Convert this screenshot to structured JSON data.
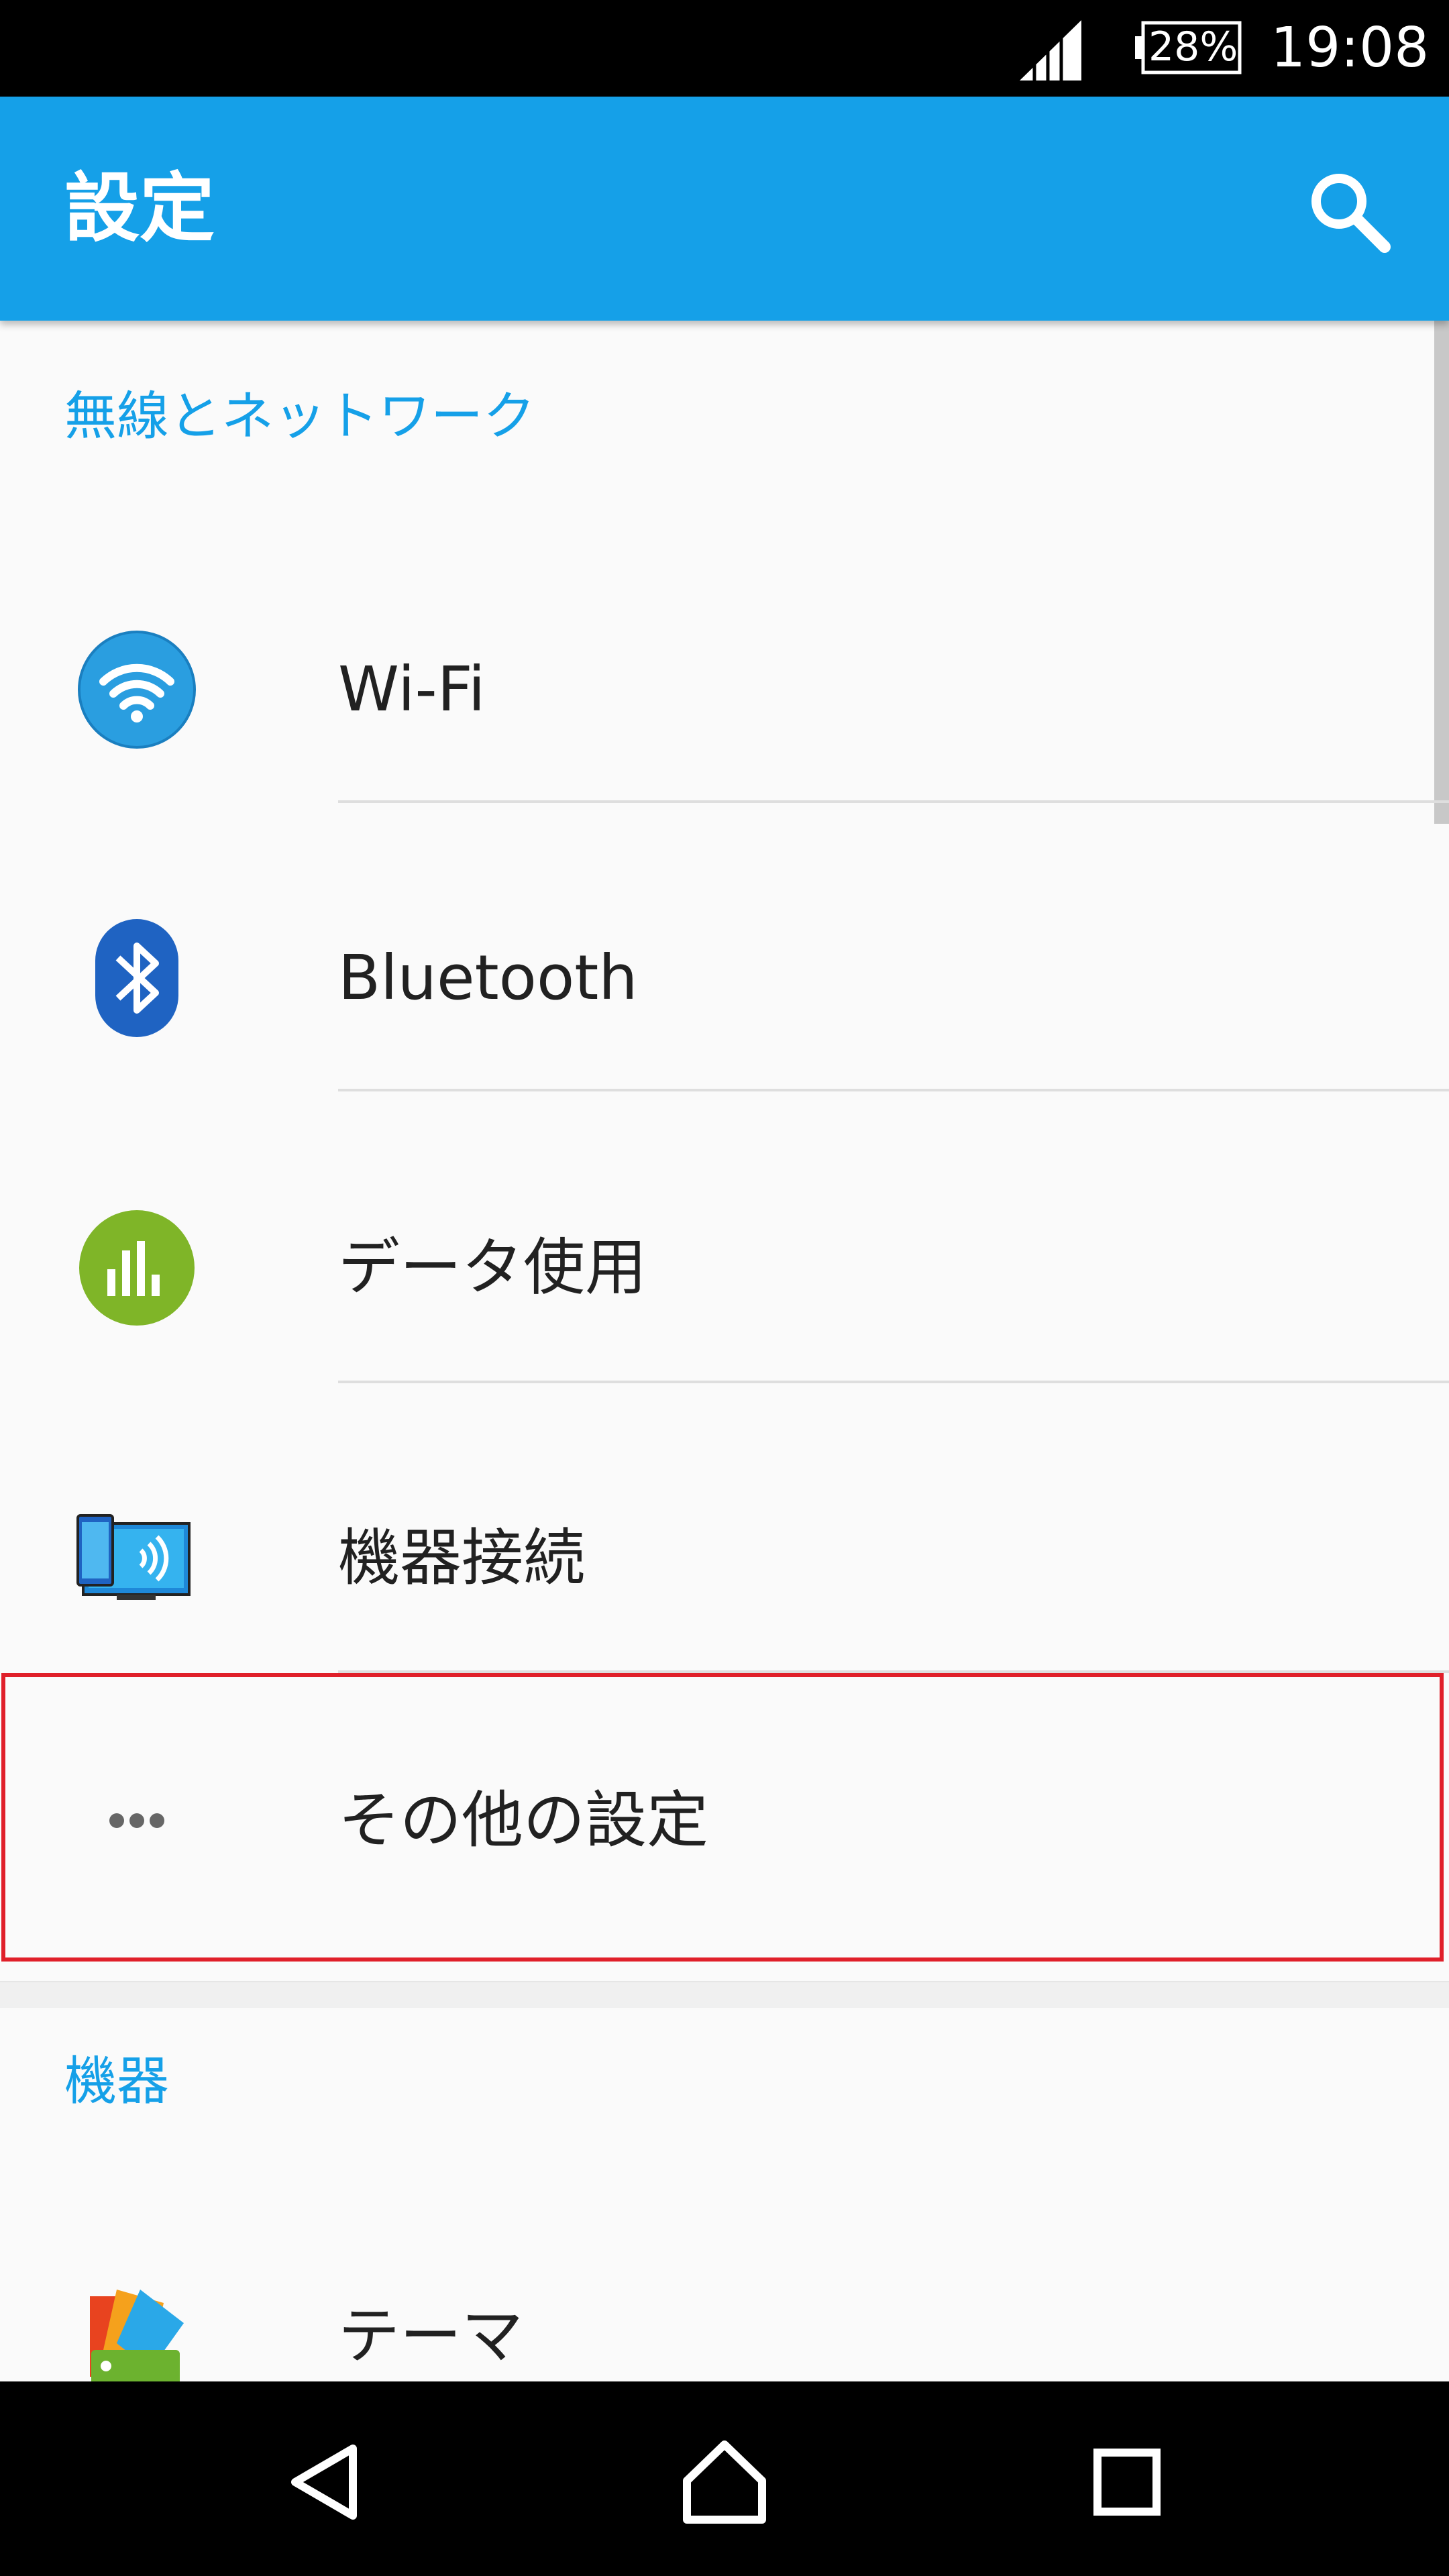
{
  "status_bar": {
    "battery": "28%",
    "time": "19:08",
    "icons": [
      "signal-icon",
      "battery-icon"
    ]
  },
  "app_bar": {
    "title": "設定",
    "search_icon": "search-icon"
  },
  "sections": [
    {
      "header": "無線とネットワーク",
      "items": [
        {
          "label": "Wi-Fi",
          "icon": "wifi-icon"
        },
        {
          "label": "Bluetooth",
          "icon": "bluetooth-icon"
        },
        {
          "label": "データ使用",
          "icon": "data-usage-icon"
        },
        {
          "label": "機器接続",
          "icon": "device-connection-icon"
        },
        {
          "label": "その他の設定",
          "icon": "more-icon",
          "highlighted": true
        }
      ]
    },
    {
      "header": "機器",
      "items": [
        {
          "label": "テーマ",
          "icon": "theme-icon"
        }
      ]
    }
  ],
  "nav_bar": {
    "icons": [
      "back-icon",
      "home-icon",
      "recents-icon"
    ]
  },
  "colors": {
    "accent": "#15a0e8",
    "highlight": "#e0202a"
  }
}
